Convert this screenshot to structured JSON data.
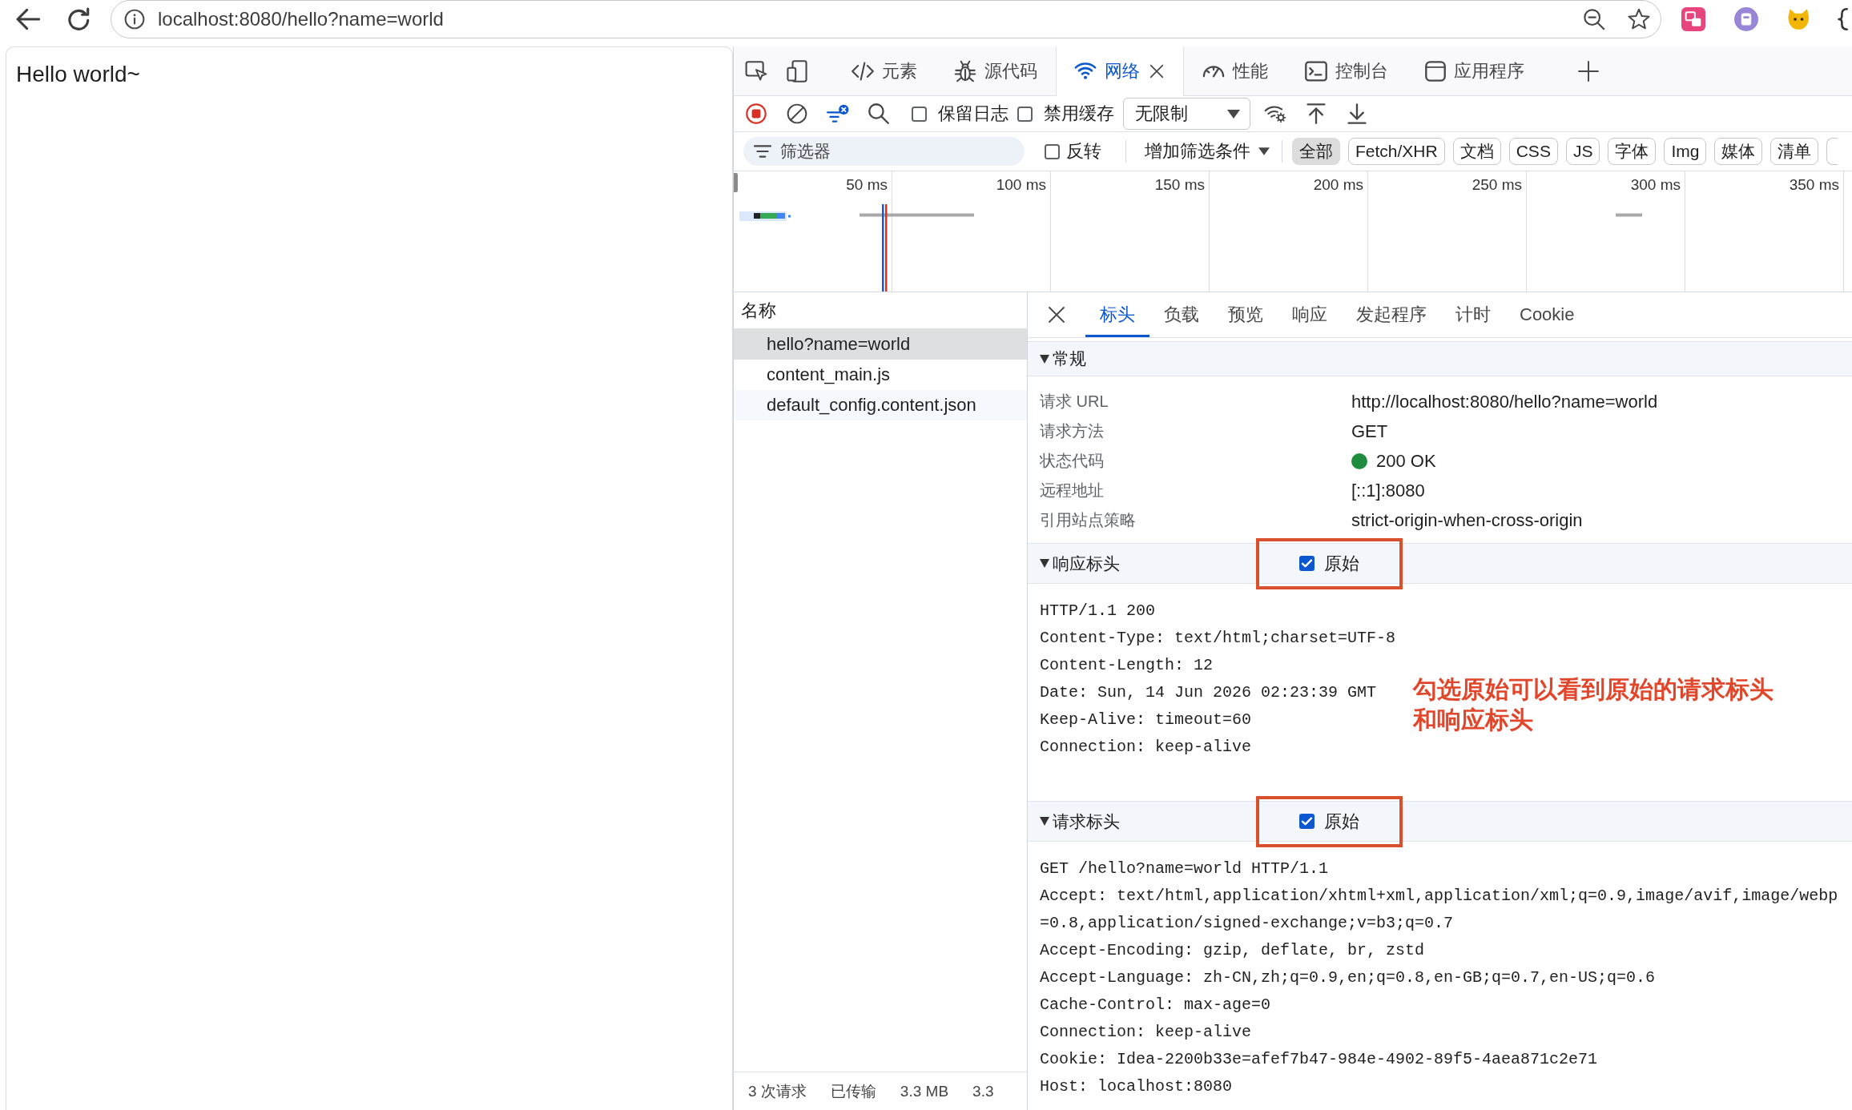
{
  "browser": {
    "url": "localhost:8080/hello?name=world"
  },
  "page": {
    "text": "Hello world~"
  },
  "devtools": {
    "panels": [
      {
        "kind": "elements",
        "label": "元素",
        "selected": false,
        "closable": false
      },
      {
        "kind": "sources",
        "label": "源代码",
        "selected": false,
        "closable": false
      },
      {
        "kind": "network",
        "label": "网络",
        "selected": true,
        "closable": true
      },
      {
        "kind": "performance",
        "label": "性能",
        "selected": false,
        "closable": false
      },
      {
        "kind": "console",
        "label": "控制台",
        "selected": false,
        "closable": false
      },
      {
        "kind": "application",
        "label": "应用程序",
        "selected": false,
        "closable": false
      }
    ],
    "toolbar": {
      "recording": true,
      "options": [
        {
          "label": "保留日志",
          "checked": false
        },
        {
          "label": "禁用缓存",
          "checked": false
        }
      ],
      "throttling": "无限制"
    },
    "filter_bar": {
      "placeholder": "筛选器",
      "invert": {
        "label": "反转",
        "checked": false
      },
      "more_filters": "增加筛选条件",
      "types": [
        {
          "label": "全部",
          "selected": true
        },
        {
          "label": "Fetch/XHR",
          "selected": false
        },
        {
          "label": "文档",
          "selected": false
        },
        {
          "label": "CSS",
          "selected": false
        },
        {
          "label": "JS",
          "selected": false
        },
        {
          "label": "字体",
          "selected": false
        },
        {
          "label": "Img",
          "selected": false
        },
        {
          "label": "媒体",
          "selected": false
        },
        {
          "label": "清单",
          "selected": false
        }
      ]
    },
    "timeline": {
      "ticks": [
        "50 ms",
        "100 ms",
        "150 ms",
        "200 ms",
        "250 ms",
        "300 ms",
        "350 ms"
      ]
    },
    "requests": {
      "column": "名称",
      "rows": [
        {
          "name": "hello?name=world",
          "selected": true
        },
        {
          "name": "content_main.js",
          "selected": false
        },
        {
          "name": "default_config.content.json",
          "selected": false
        }
      ]
    },
    "status_bar": [
      "3 次请求",
      "已传输",
      "3.3 MB",
      "3.3"
    ],
    "details": {
      "tabs": [
        {
          "label": "标头",
          "selected": true
        },
        {
          "label": "负载",
          "selected": false
        },
        {
          "label": "预览",
          "selected": false
        },
        {
          "label": "响应",
          "selected": false
        },
        {
          "label": "发起程序",
          "selected": false
        },
        {
          "label": "计时",
          "selected": false
        },
        {
          "label": "Cookie",
          "selected": false
        }
      ],
      "sections": [
        {
          "kind": "general",
          "title": "常规",
          "expanded": true,
          "rows": [
            {
              "kind": "text",
              "label": "请求 URL",
              "value": "http://localhost:8080/hello?name=world"
            },
            {
              "kind": "text",
              "label": "请求方法",
              "value": "GET"
            },
            {
              "kind": "status",
              "label": "状态代码",
              "value": "200 OK"
            },
            {
              "kind": "text",
              "label": "远程地址",
              "value": "[::1]:8080"
            },
            {
              "kind": "text",
              "label": "引用站点策略",
              "value": "strict-origin-when-cross-origin"
            }
          ]
        },
        {
          "kind": "raw",
          "title": "响应标头",
          "expanded": true,
          "raw_toggle": {
            "label": "原始",
            "checked": true,
            "highlighted": true
          },
          "lines": [
            "HTTP/1.1 200",
            "Content-Type: text/html;charset=UTF-8",
            "Content-Length: 12",
            "Date: Sun, 14 Jun 2026 02:23:39 GMT",
            "Keep-Alive: timeout=60",
            "Connection: keep-alive"
          ],
          "note": [
            "勾选原始可以看到原始的请求标头",
            "和响应标头"
          ]
        },
        {
          "kind": "raw",
          "title": "请求标头",
          "expanded": true,
          "raw_toggle": {
            "label": "原始",
            "checked": true,
            "highlighted": true
          },
          "lines": [
            "GET /hello?name=world HTTP/1.1",
            "Accept: text/html,application/xhtml+xml,application/xml;q=0.9,image/avif,image/webp",
            "=0.8,application/signed-exchange;v=b3;q=0.7",
            "Accept-Encoding: gzip, deflate, br, zstd",
            "Accept-Language: zh-CN,zh;q=0.9,en;q=0.8,en-GB;q=0.7,en-US;q=0.6",
            "Cache-Control: max-age=0",
            "Connection: keep-alive",
            "Cookie: Idea-2200b33e=afef7b47-984e-4902-89f5-4aea871c2e71",
            "Host: localhost:8080"
          ]
        }
      ]
    }
  }
}
